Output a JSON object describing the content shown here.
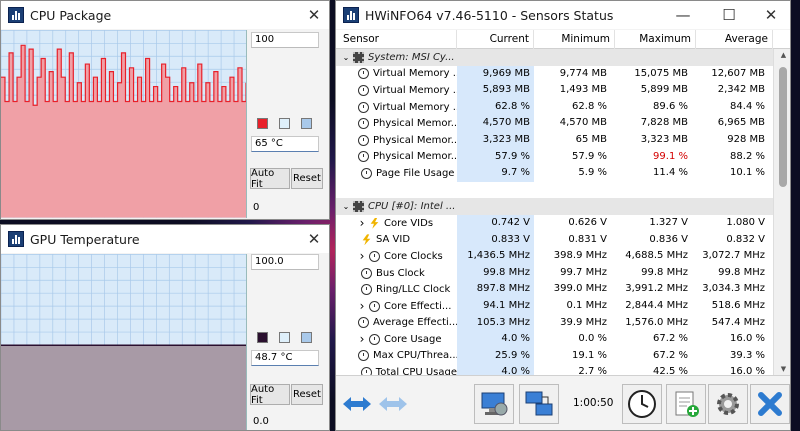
{
  "cpu_window": {
    "title": "CPU Package",
    "max_value": "100",
    "current_value": "65 °C",
    "min_value": "0",
    "autofit_label": "Auto Fit",
    "reset_label": "Reset",
    "line_color": "#e8202a",
    "fill_color": "#f0a0a6",
    "trace": [
      75,
      62,
      88,
      62,
      75,
      92,
      62,
      90,
      60,
      75,
      85,
      62,
      78,
      62,
      90,
      75,
      62,
      88,
      62,
      72,
      62,
      82,
      62,
      75,
      62,
      85,
      62,
      78,
      62,
      72,
      88,
      62,
      80,
      62,
      75,
      62,
      85,
      62,
      70,
      62,
      82,
      75,
      62,
      70,
      62,
      80,
      62,
      72,
      62,
      82,
      62,
      72,
      62,
      78,
      62,
      70,
      62,
      75,
      62,
      80,
      62,
      72
    ]
  },
  "gpu_window": {
    "title": "GPU Temperature",
    "max_value": "100.0",
    "current_value": "48.7 °C",
    "min_value": "0.0",
    "autofit_label": "Auto Fit",
    "reset_label": "Reset",
    "line_color": "#2a0f2e",
    "fill_color": "#a89aa6",
    "level": 48.7
  },
  "sensors_window": {
    "title": "HWiNFO64 v7.46-5110 - Sensors Status",
    "columns": [
      "Sensor",
      "Current",
      "Minimum",
      "Maximum",
      "Average"
    ],
    "elapsed": "1:00:50",
    "rows": [
      {
        "type": "group",
        "name": "System: MSI Cy..."
      },
      {
        "icon": "clock",
        "name": "Virtual Memory ...",
        "cur": "9,969 MB",
        "min": "9,774 MB",
        "max": "15,075 MB",
        "avg": "12,607 MB"
      },
      {
        "icon": "clock",
        "name": "Virtual Memory ...",
        "cur": "5,893 MB",
        "min": "1,493 MB",
        "max": "5,899 MB",
        "avg": "2,342 MB"
      },
      {
        "icon": "clock",
        "name": "Virtual Memory ...",
        "cur": "62.8 %",
        "min": "62.8 %",
        "max": "89.6 %",
        "avg": "84.4 %"
      },
      {
        "icon": "clock",
        "name": "Physical Memor...",
        "cur": "4,570 MB",
        "min": "4,570 MB",
        "max": "7,828 MB",
        "avg": "6,965 MB"
      },
      {
        "icon": "clock",
        "name": "Physical Memor...",
        "cur": "3,323 MB",
        "min": "65 MB",
        "max": "3,323 MB",
        "avg": "928 MB"
      },
      {
        "icon": "clock",
        "name": "Physical Memor...",
        "cur": "57.9 %",
        "min": "57.9 %",
        "max": "99.1 %",
        "max_red": true,
        "avg": "88.2 %"
      },
      {
        "icon": "clock",
        "name": "Page File Usage",
        "cur": "9.7 %",
        "min": "5.9 %",
        "max": "11.4 %",
        "avg": "10.1 %"
      },
      {
        "type": "blank"
      },
      {
        "type": "group",
        "name": "CPU [#0]: Intel ..."
      },
      {
        "icon": "bolt",
        "expand": true,
        "name": "Core VIDs",
        "cur": "0.742 V",
        "min": "0.626 V",
        "max": "1.327 V",
        "avg": "1.080 V"
      },
      {
        "icon": "bolt",
        "name": "SA VID",
        "cur": "0.833 V",
        "min": "0.831 V",
        "max": "0.836 V",
        "avg": "0.832 V"
      },
      {
        "icon": "clock",
        "expand": true,
        "name": "Core Clocks",
        "cur": "1,436.5 MHz",
        "min": "398.9 MHz",
        "max": "4,688.5 MHz",
        "avg": "3,072.7 MHz"
      },
      {
        "icon": "clock",
        "name": "Bus Clock",
        "cur": "99.8 MHz",
        "min": "99.7 MHz",
        "max": "99.8 MHz",
        "avg": "99.8 MHz"
      },
      {
        "icon": "clock",
        "name": "Ring/LLC Clock",
        "cur": "897.8 MHz",
        "min": "399.0 MHz",
        "max": "3,991.2 MHz",
        "avg": "3,034.3 MHz"
      },
      {
        "icon": "clock",
        "expand": true,
        "name": "Core Effecti...",
        "cur": "94.1 MHz",
        "min": "0.1 MHz",
        "max": "2,844.4 MHz",
        "avg": "518.6 MHz"
      },
      {
        "icon": "clock",
        "name": "Average Effecti...",
        "cur": "105.3 MHz",
        "min": "39.9 MHz",
        "max": "1,576.0 MHz",
        "avg": "547.4 MHz"
      },
      {
        "icon": "clock",
        "expand": true,
        "name": "Core Usage",
        "cur": "4.0 %",
        "min": "0.0 %",
        "max": "67.2 %",
        "avg": "16.0 %"
      },
      {
        "icon": "clock",
        "name": "Max CPU/Threa...",
        "cur": "25.9 %",
        "min": "19.1 %",
        "max": "67.2 %",
        "avg": "39.3 %"
      },
      {
        "icon": "clock",
        "name": "Total CPU Usage",
        "cur": "4.0 %",
        "min": "2.7 %",
        "max": "42.5 %",
        "avg": "16.0 %"
      }
    ]
  },
  "colors": {
    "current_highlight": "#d7e8fb",
    "group_bg": "#e6e6e6",
    "plot_bg": "#d9eaf9",
    "grid": "#a9c9ea",
    "red": "#d40000"
  },
  "icons": [
    "hwinfo-app-icon",
    "close-icon",
    "minimize-icon",
    "maximize-icon",
    "expand-arrow-icon",
    "collapse-arrow-icon",
    "clock-gauge-icon",
    "voltage-bolt-icon",
    "chip-icon",
    "nav-left-right-icon",
    "nav-back-icon",
    "network-icon",
    "pc-settings-icon",
    "timer-clock-icon",
    "add-report-icon",
    "gear-icon",
    "close-x-icon"
  ]
}
